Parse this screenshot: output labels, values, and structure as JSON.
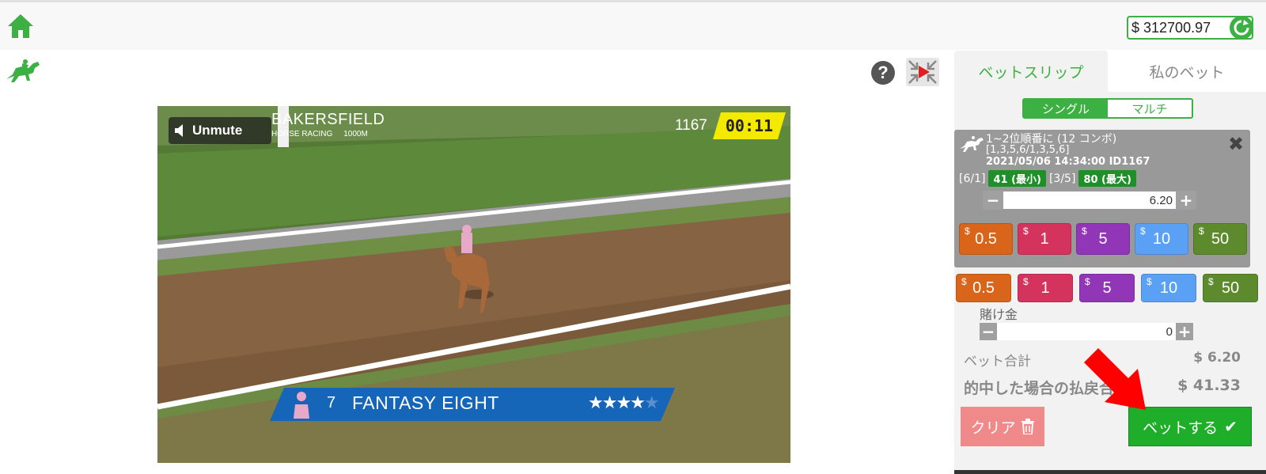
{
  "header": {
    "balance": "$ 312700.97"
  },
  "video": {
    "unmute_label": "Unmute",
    "track_name": "BAKERSFIELD",
    "track_type": "HORSE RACING",
    "track_distance": "1000M",
    "race_id": "1167",
    "timer": "00:11",
    "leader_number": "7",
    "leader_name": "FANTASY EIGHT",
    "leader_stars": "★★★★",
    "leader_star_empty": "★",
    "leader_rating": 3.5
  },
  "tabs": {
    "betslip": "ベットスリップ",
    "mybets": "私のベット"
  },
  "betslip": {
    "mode_single": "シングル",
    "mode_multi": "マルチ",
    "bet": {
      "title": "1~2位順番に (12 コンボ)",
      "selection": "[1,3,5,6/1,3,5,6]",
      "datetime": "2021/05/06 14:34:00 ID1167",
      "odds_low_label": "[6/1]",
      "odds_low_badge": "41 (最小)",
      "odds_high_label": "[3/5]",
      "odds_high_badge": "80 (最大)",
      "stake": "6.20"
    },
    "chip_colors": [
      "#d9651b",
      "#d3335c",
      "#9236b8",
      "#5aa0f5",
      "#5e8a2e"
    ],
    "chips_card": [
      {
        "currency": "$",
        "value": "0.5"
      },
      {
        "currency": "$",
        "value": "1"
      },
      {
        "currency": "$",
        "value": "5"
      },
      {
        "currency": "$",
        "value": "10"
      },
      {
        "currency": "$",
        "value": "50"
      }
    ],
    "chips_main": [
      {
        "currency": "$",
        "value": "0.5"
      },
      {
        "currency": "$",
        "value": "1"
      },
      {
        "currency": "$",
        "value": "5"
      },
      {
        "currency": "$",
        "value": "10"
      },
      {
        "currency": "$",
        "value": "50"
      }
    ],
    "stake_label": "賭け金",
    "stake_value": "0",
    "total_label": "ベット合計",
    "total_value": "$ 6.20",
    "win_label": "的中した場合の払戻合計",
    "win_value": "$ 41.33",
    "clear_label": "クリア",
    "place_label": "ベットする"
  },
  "colors": {
    "accent": "#3cb043",
    "place_button": "#1fae2a",
    "clear_button": "#f08a8a",
    "timer_bg": "#f4ea00",
    "leader_banner": "#1565b8",
    "arrow": "#ff0000"
  }
}
